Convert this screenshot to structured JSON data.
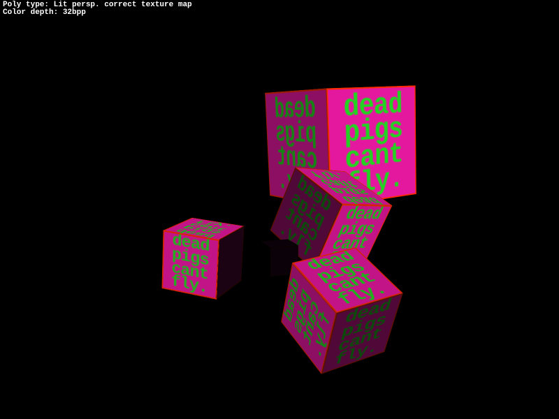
{
  "overlay": {
    "line1": "Poly type: Lit persp. correct texture map",
    "line2": "Color depth: 32bpp"
  },
  "texture": {
    "row1": "dead",
    "row2": "pigs",
    "row3": "cant",
    "row4": "fly."
  },
  "colors": {
    "background": "#000000",
    "overlay_text": "#ffffff",
    "face_bg": "#e4189f",
    "face_edge": "#ff2a00",
    "tex_text": "#23d321"
  }
}
